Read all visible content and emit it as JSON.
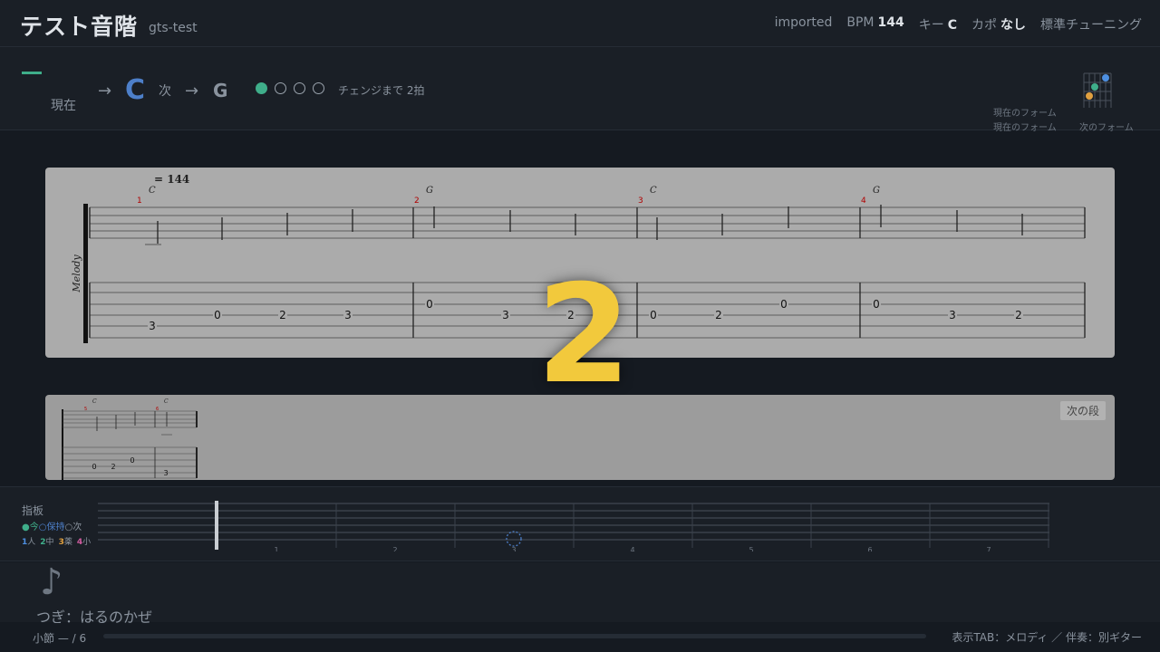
{
  "header": {
    "title": "テスト音階",
    "slug": "gts-test",
    "source": "imported",
    "bpm_label": "BPM",
    "bpm": "144",
    "key_label": "キー",
    "key": "C",
    "capo_label": "カポ",
    "capo": "なし",
    "tuning": "標準チューニング"
  },
  "chordbar": {
    "current_label": "現在",
    "arrow": "→",
    "current_chord": "C",
    "next_label": "次",
    "next_chord": "G",
    "beats_filled": 1,
    "beats_total": 4,
    "change_text": "チェンジまで 2拍",
    "current_form_label": "現在のフォーム",
    "next_form_label": "次のフォーム"
  },
  "score": {
    "tempo": "= 144",
    "track": "Melody",
    "measures": [
      {
        "num": "1",
        "chord": "C"
      },
      {
        "num": "2",
        "chord": "G"
      },
      {
        "num": "3",
        "chord": "C"
      },
      {
        "num": "4",
        "chord": "G"
      }
    ],
    "tab_numbers": [
      "3",
      "0",
      "2",
      "3",
      "0",
      "3",
      "2",
      "0",
      "2",
      "0",
      "0",
      "3",
      "2"
    ],
    "next_row_badge": "次の段",
    "next_measures": [
      {
        "num": "5",
        "chord": "C"
      },
      {
        "num": "6",
        "chord": "C"
      }
    ],
    "next_tab_numbers": [
      "0",
      "2",
      "0",
      "3"
    ],
    "countdown": "2"
  },
  "fretboard": {
    "title": "指板",
    "legend_now": "●今",
    "legend_hold": "○保持",
    "legend_next": "○次",
    "fingers": [
      {
        "n": "1",
        "label": "人",
        "color": "#4d8fe0"
      },
      {
        "n": "2",
        "label": "中",
        "color": "#3fae8a"
      },
      {
        "n": "3",
        "label": "薬",
        "color": "#e0a040"
      },
      {
        "n": "4",
        "label": "小",
        "color": "#d05ca0"
      }
    ],
    "fret_numbers": [
      "1",
      "2",
      "3",
      "4",
      "5",
      "6",
      "7"
    ]
  },
  "song": {
    "note_icon": "♪",
    "next_song": "つぎ：はるのかぜ"
  },
  "status": {
    "measure": "小節 — / 6",
    "progress": 0,
    "display": "表示TAB：メロディ ／ 伴奏：別ギター"
  },
  "colors": {
    "accent_green": "#3fae8a",
    "accent_blue": "#4d7fc9",
    "countdown": "#f2c93c",
    "measure_number": "#b00000"
  }
}
